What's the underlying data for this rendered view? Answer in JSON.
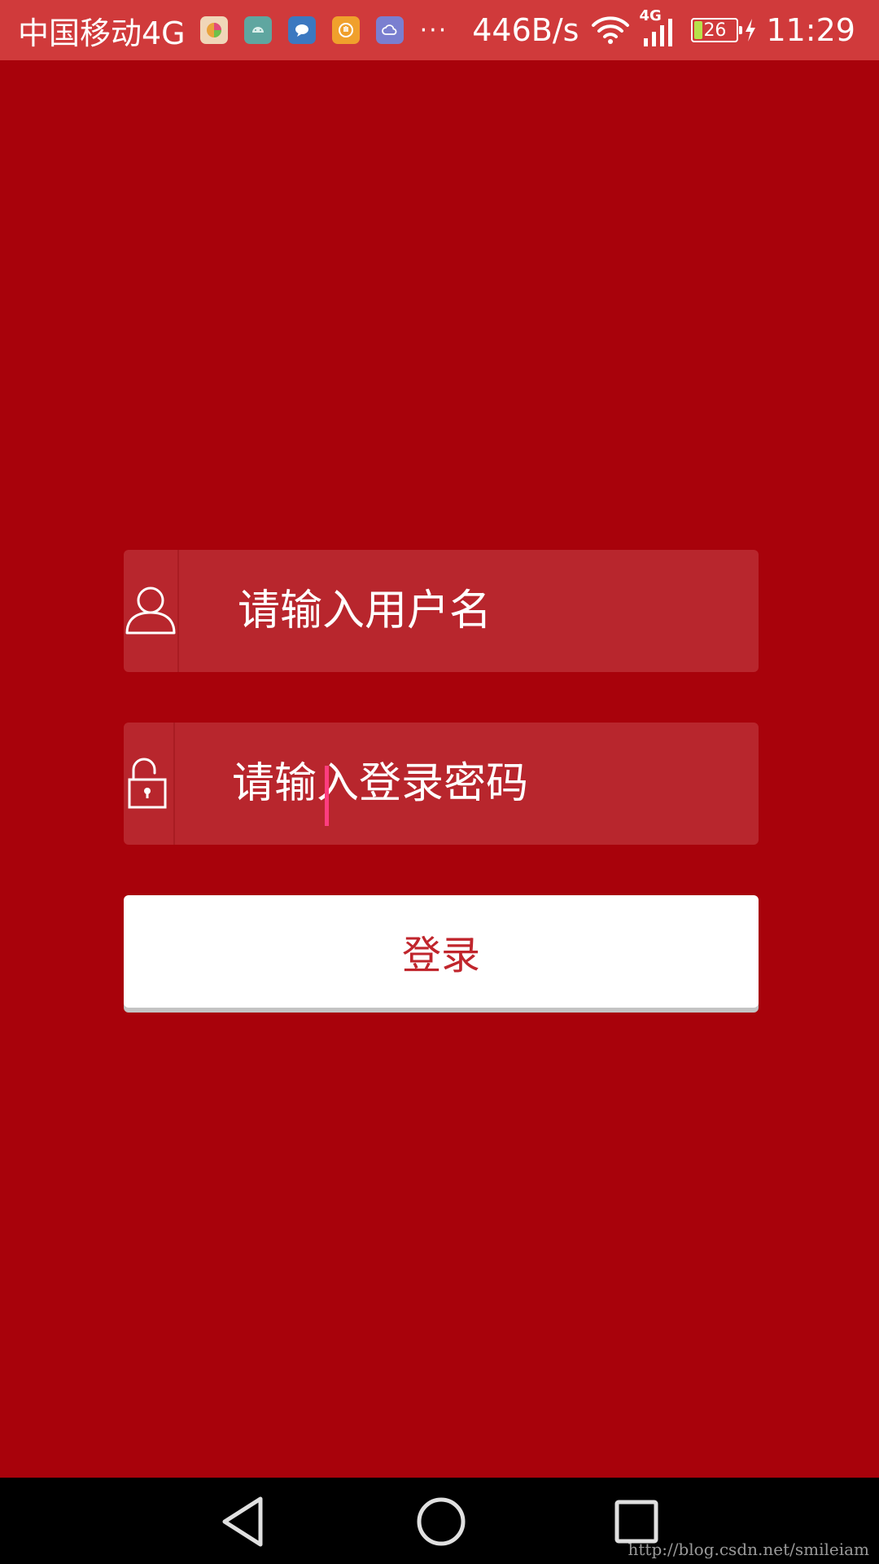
{
  "status_bar": {
    "carrier": "中国移动4G",
    "network_speed": "446B/s",
    "network_type": "4G",
    "battery_level": "26",
    "time": "11:29",
    "notification_icons": [
      "color-app-icon",
      "android-icon",
      "chat-icon",
      "hand-icon",
      "cloud-icon"
    ],
    "more": "···"
  },
  "login_form": {
    "username_placeholder": "请输入用户名",
    "password_placeholder": "请输入登录密码",
    "username_icon": "user-icon",
    "password_icon": "unlock-icon"
  },
  "login_button": {
    "label": "登录"
  },
  "nav_bar": {
    "buttons": [
      "back-icon",
      "home-icon",
      "recent-apps-icon"
    ]
  },
  "watermark": "http://blog.csdn.net/smileiam",
  "colors": {
    "background": "#a8020b",
    "status_bar": "#d03a3b",
    "field": "#b8262d",
    "button_text": "#c0252c",
    "cursor": "#ff3d7f"
  }
}
